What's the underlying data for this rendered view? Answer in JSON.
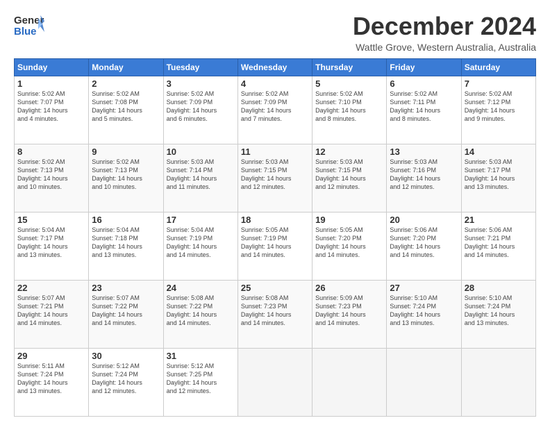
{
  "header": {
    "logo_general": "General",
    "logo_blue": "Blue",
    "month": "December 2024",
    "location": "Wattle Grove, Western Australia, Australia"
  },
  "days_of_week": [
    "Sunday",
    "Monday",
    "Tuesday",
    "Wednesday",
    "Thursday",
    "Friday",
    "Saturday"
  ],
  "weeks": [
    [
      {
        "day": "1",
        "info": "Sunrise: 5:02 AM\nSunset: 7:07 PM\nDaylight: 14 hours\nand 4 minutes."
      },
      {
        "day": "2",
        "info": "Sunrise: 5:02 AM\nSunset: 7:08 PM\nDaylight: 14 hours\nand 5 minutes."
      },
      {
        "day": "3",
        "info": "Sunrise: 5:02 AM\nSunset: 7:09 PM\nDaylight: 14 hours\nand 6 minutes."
      },
      {
        "day": "4",
        "info": "Sunrise: 5:02 AM\nSunset: 7:09 PM\nDaylight: 14 hours\nand 7 minutes."
      },
      {
        "day": "5",
        "info": "Sunrise: 5:02 AM\nSunset: 7:10 PM\nDaylight: 14 hours\nand 8 minutes."
      },
      {
        "day": "6",
        "info": "Sunrise: 5:02 AM\nSunset: 7:11 PM\nDaylight: 14 hours\nand 8 minutes."
      },
      {
        "day": "7",
        "info": "Sunrise: 5:02 AM\nSunset: 7:12 PM\nDaylight: 14 hours\nand 9 minutes."
      }
    ],
    [
      {
        "day": "8",
        "info": "Sunrise: 5:02 AM\nSunset: 7:13 PM\nDaylight: 14 hours\nand 10 minutes."
      },
      {
        "day": "9",
        "info": "Sunrise: 5:02 AM\nSunset: 7:13 PM\nDaylight: 14 hours\nand 10 minutes."
      },
      {
        "day": "10",
        "info": "Sunrise: 5:03 AM\nSunset: 7:14 PM\nDaylight: 14 hours\nand 11 minutes."
      },
      {
        "day": "11",
        "info": "Sunrise: 5:03 AM\nSunset: 7:15 PM\nDaylight: 14 hours\nand 12 minutes."
      },
      {
        "day": "12",
        "info": "Sunrise: 5:03 AM\nSunset: 7:15 PM\nDaylight: 14 hours\nand 12 minutes."
      },
      {
        "day": "13",
        "info": "Sunrise: 5:03 AM\nSunset: 7:16 PM\nDaylight: 14 hours\nand 12 minutes."
      },
      {
        "day": "14",
        "info": "Sunrise: 5:03 AM\nSunset: 7:17 PM\nDaylight: 14 hours\nand 13 minutes."
      }
    ],
    [
      {
        "day": "15",
        "info": "Sunrise: 5:04 AM\nSunset: 7:17 PM\nDaylight: 14 hours\nand 13 minutes."
      },
      {
        "day": "16",
        "info": "Sunrise: 5:04 AM\nSunset: 7:18 PM\nDaylight: 14 hours\nand 13 minutes."
      },
      {
        "day": "17",
        "info": "Sunrise: 5:04 AM\nSunset: 7:19 PM\nDaylight: 14 hours\nand 14 minutes."
      },
      {
        "day": "18",
        "info": "Sunrise: 5:05 AM\nSunset: 7:19 PM\nDaylight: 14 hours\nand 14 minutes."
      },
      {
        "day": "19",
        "info": "Sunrise: 5:05 AM\nSunset: 7:20 PM\nDaylight: 14 hours\nand 14 minutes."
      },
      {
        "day": "20",
        "info": "Sunrise: 5:06 AM\nSunset: 7:20 PM\nDaylight: 14 hours\nand 14 minutes."
      },
      {
        "day": "21",
        "info": "Sunrise: 5:06 AM\nSunset: 7:21 PM\nDaylight: 14 hours\nand 14 minutes."
      }
    ],
    [
      {
        "day": "22",
        "info": "Sunrise: 5:07 AM\nSunset: 7:21 PM\nDaylight: 14 hours\nand 14 minutes."
      },
      {
        "day": "23",
        "info": "Sunrise: 5:07 AM\nSunset: 7:22 PM\nDaylight: 14 hours\nand 14 minutes."
      },
      {
        "day": "24",
        "info": "Sunrise: 5:08 AM\nSunset: 7:22 PM\nDaylight: 14 hours\nand 14 minutes."
      },
      {
        "day": "25",
        "info": "Sunrise: 5:08 AM\nSunset: 7:23 PM\nDaylight: 14 hours\nand 14 minutes."
      },
      {
        "day": "26",
        "info": "Sunrise: 5:09 AM\nSunset: 7:23 PM\nDaylight: 14 hours\nand 14 minutes."
      },
      {
        "day": "27",
        "info": "Sunrise: 5:10 AM\nSunset: 7:24 PM\nDaylight: 14 hours\nand 13 minutes."
      },
      {
        "day": "28",
        "info": "Sunrise: 5:10 AM\nSunset: 7:24 PM\nDaylight: 14 hours\nand 13 minutes."
      }
    ],
    [
      {
        "day": "29",
        "info": "Sunrise: 5:11 AM\nSunset: 7:24 PM\nDaylight: 14 hours\nand 13 minutes."
      },
      {
        "day": "30",
        "info": "Sunrise: 5:12 AM\nSunset: 7:24 PM\nDaylight: 14 hours\nand 12 minutes."
      },
      {
        "day": "31",
        "info": "Sunrise: 5:12 AM\nSunset: 7:25 PM\nDaylight: 14 hours\nand 12 minutes."
      },
      null,
      null,
      null,
      null
    ]
  ]
}
